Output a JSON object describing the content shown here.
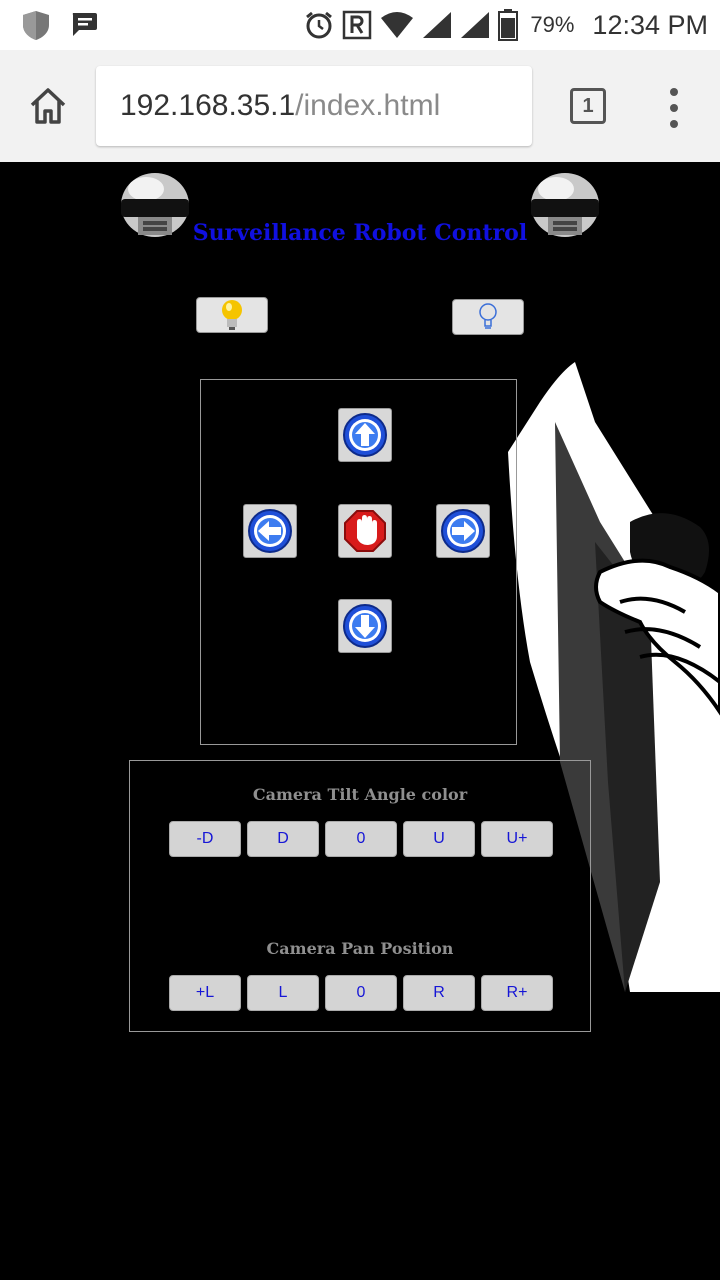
{
  "status_bar": {
    "battery": "79%",
    "time": "12:34 PM",
    "icons": [
      "shield-icon",
      "message-icon",
      "alarm-icon",
      "roaming-icon",
      "wifi-icon",
      "signal-icon",
      "battery-icon"
    ]
  },
  "browser": {
    "url_host": "192.168.35.1",
    "url_path": "/index.html",
    "tab_count": "1"
  },
  "page": {
    "title": "Surveillance Robot Control",
    "light_buttons": [
      "light-on-bulb-icon",
      "light-off-bulb-icon"
    ],
    "drive_buttons": [
      "up-arrow-icon",
      "left-arrow-icon",
      "stop-hand-icon",
      "right-arrow-icon",
      "down-arrow-icon"
    ],
    "camera": {
      "tilt_label": "Camera Tilt Angle color",
      "tilt_buttons": [
        "-D",
        "D",
        "0",
        "U",
        "U+"
      ],
      "pan_label": "Camera Pan Position",
      "pan_buttons": [
        "+L",
        "L",
        "0",
        "R",
        "R+"
      ]
    }
  },
  "colors": {
    "title": "#1010e0",
    "button_text": "#1616d6",
    "page_bg": "#000000"
  }
}
